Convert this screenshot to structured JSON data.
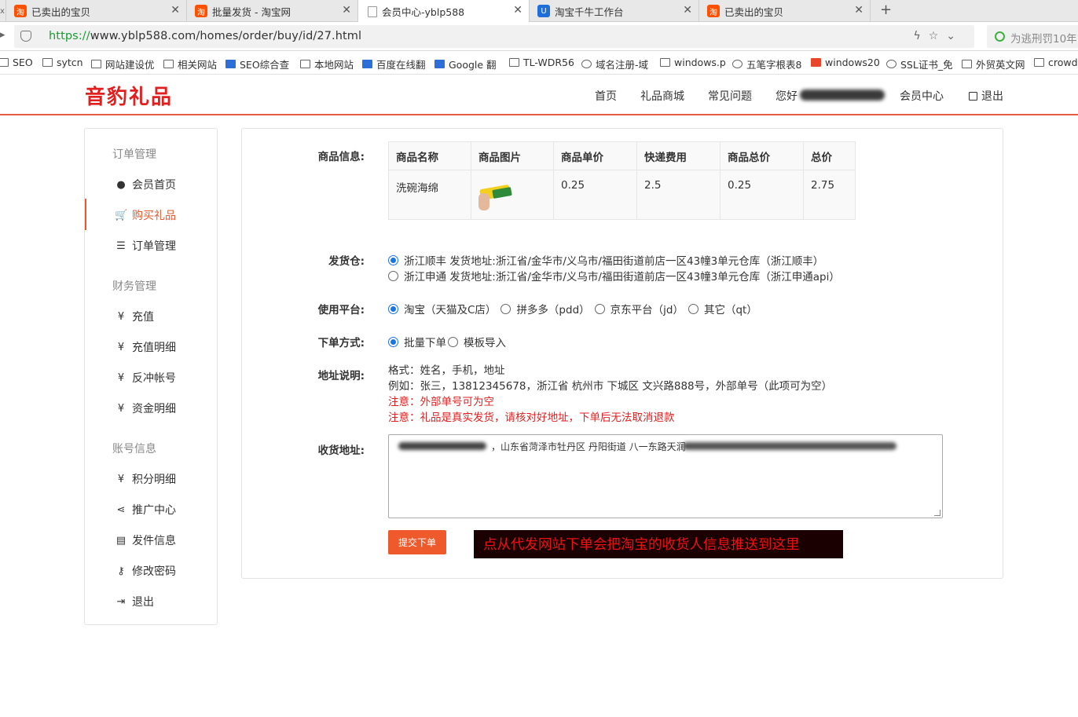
{
  "browser": {
    "tabs": [
      {
        "title": "已卖出的宝贝",
        "icon": "taobao-icon"
      },
      {
        "title": "批量发货 - 淘宝网",
        "icon": "taobao-icon"
      },
      {
        "title": "会员中心-yblp588",
        "icon": "page-icon"
      },
      {
        "title": "淘宝千牛工作台",
        "icon": "qianniu-icon"
      },
      {
        "title": "已卖出的宝贝",
        "icon": "taobao-icon"
      }
    ],
    "new_tab": "+",
    "url_scheme": "https://",
    "url_rest": "www.yblp588.com/homes/order/buy/id/27.html",
    "search_placeholder": "为逃刑罚10年",
    "bookmarks": [
      "SEO",
      "sytcn",
      "网站建设优",
      "相关网站",
      "SEO综合查",
      "本地网站",
      "百度在线翻",
      "Google 翻",
      "TL-WDR56",
      "域名注册-域",
      "windows.p",
      "五笔字根表8",
      "windows20",
      "SSL证书_免",
      "外贸英文网",
      "crowd"
    ]
  },
  "site": {
    "logo": "音豹礼品",
    "nav": {
      "home": "首页",
      "mall": "礼品商城",
      "faq": "常见问题",
      "greeting": "您好",
      "member": "会员中心",
      "logout": "退出"
    }
  },
  "sidebar": {
    "groups": [
      {
        "title": "订单管理",
        "items": [
          "会员首页",
          "购买礼品",
          "订单管理"
        ]
      },
      {
        "title": "财务管理",
        "items": [
          "充值",
          "充值明细",
          "反冲帐号",
          "资金明细"
        ]
      },
      {
        "title": "账号信息",
        "items": [
          "积分明细",
          "推广中心",
          "发件信息",
          "修改密码",
          "退出"
        ]
      }
    ],
    "active_item": "购买礼品",
    "yen": "¥"
  },
  "form": {
    "labels": {
      "goods": "商品信息:",
      "warehouse": "发货仓:",
      "platform": "使用平台:",
      "order_method": "下单方式:",
      "address_note": "地址说明:",
      "address": "收货地址:"
    },
    "table": {
      "headers": [
        "商品名称",
        "商品图片",
        "商品单价",
        "快递费用",
        "商品总价",
        "总价"
      ],
      "row": {
        "name": "洗碗海绵",
        "unit_price": "0.25",
        "shipping": "2.5",
        "subtotal": "0.25",
        "total": "2.75"
      }
    },
    "warehouses": [
      {
        "label": "浙江顺丰   发货地址:浙江省/金华市/义乌市/福田街道前店一区43幢3单元仓库（浙江顺丰）",
        "checked": true
      },
      {
        "label": "浙江申通   发货地址:浙江省/金华市/义乌市/福田街道前店一区43幢3单元仓库（浙江申通api）",
        "checked": false
      }
    ],
    "platforms": [
      {
        "label": "淘宝（天猫及C店）",
        "checked": true
      },
      {
        "label": "拼多多（pdd）",
        "checked": false
      },
      {
        "label": "京东平台（jd）",
        "checked": false
      },
      {
        "label": "其它（qt）",
        "checked": false
      }
    ],
    "order_methods": [
      {
        "label": "批量下单",
        "checked": true
      },
      {
        "label": "模板导入",
        "checked": false
      }
    ],
    "address_notes": {
      "format": "格式：姓名，手机，地址",
      "example": "例如：张三，13812345678，浙江省 杭州市 下城区 文兴路888号，外部单号（此项可为空）",
      "warn1": "注意：外部单号可为空",
      "warn2": "注意：礼品是真实发货，请核对好地址，下单后无法取消退款"
    },
    "address_value": "，山东省菏泽市牡丹区 丹阳街道  八一东路天润",
    "submit": "提交下单",
    "overlay_note": "点从代发网站下单会把淘宝的收货人信息推送到这里"
  },
  "colors": {
    "accent": "#e8592c",
    "logo": "#e21f1f",
    "warning": "#e21f1f",
    "submit": "#ee5a2c"
  }
}
